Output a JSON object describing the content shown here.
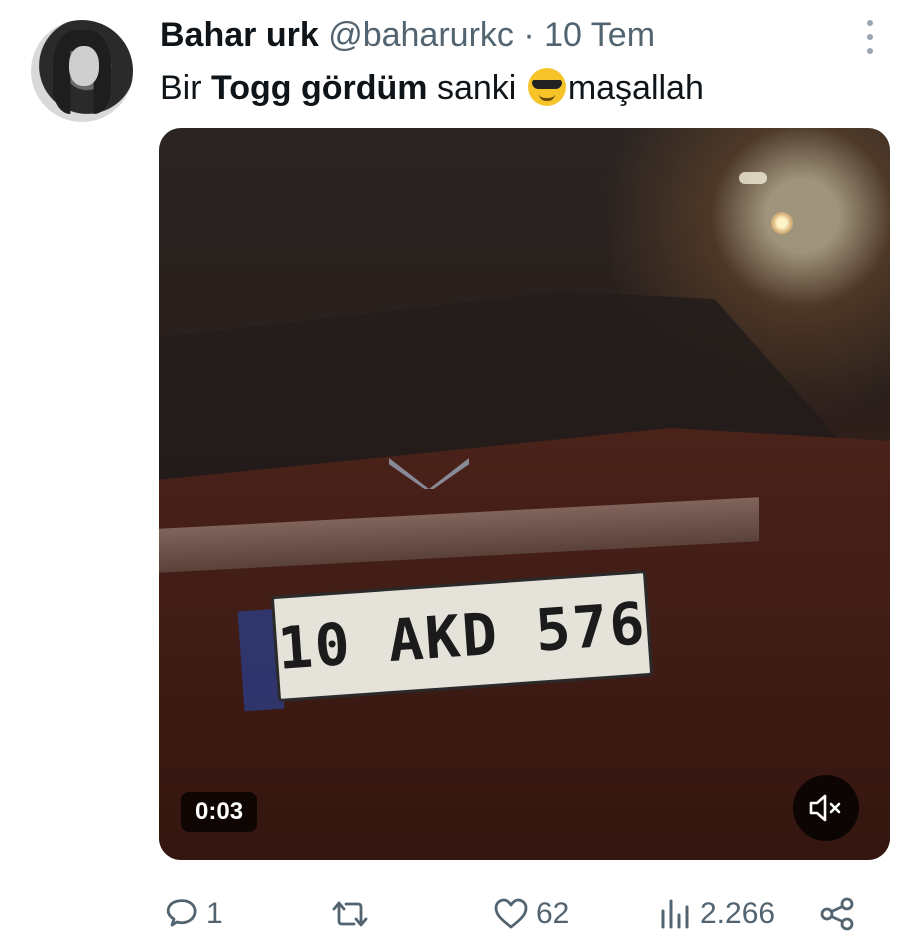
{
  "tweet": {
    "author_name": "Bahar urk",
    "handle": "@baharurkc",
    "separator": "·",
    "date": "10 Tem",
    "text_prefix": "Bir ",
    "text_bold": "Togg gördüm",
    "text_middle": " sanki ",
    "text_suffix": "maşallah"
  },
  "media": {
    "duration": "0:03",
    "plate_text": "10 AKD 576"
  },
  "actions": {
    "reply_count": "1",
    "retweet_count": "",
    "like_count": "62",
    "views_count": "2.266"
  }
}
